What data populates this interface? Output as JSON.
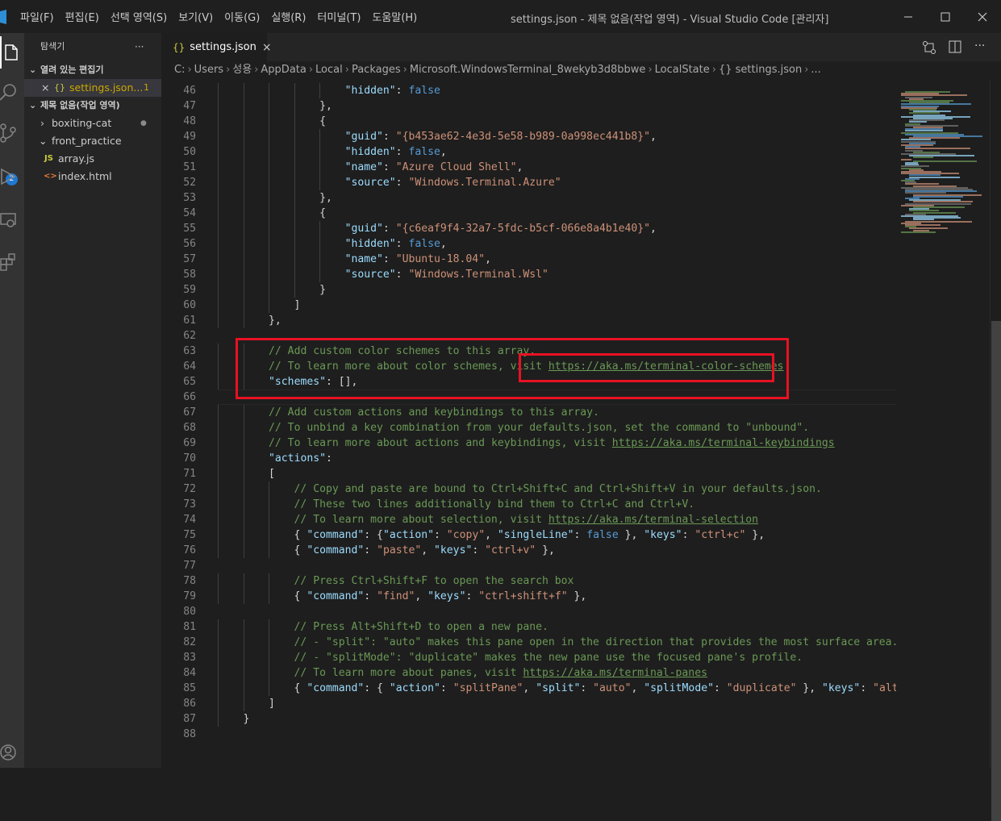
{
  "window": {
    "menu": [
      "파일(F)",
      "편집(E)",
      "선택 영역(S)",
      "보기(V)",
      "이동(G)",
      "실행(R)",
      "터미널(T)",
      "도움말(H)"
    ],
    "title": "settings.json - 제목 없음(작업 영역) - Visual Studio Code [관리자]",
    "controls": [
      "minimize",
      "maximize",
      "close"
    ]
  },
  "activity_bar": {
    "items": [
      "explorer-icon",
      "search-icon",
      "source-control-icon",
      "run-debug-icon",
      "remote-explorer-icon",
      "extensions-icon",
      "account-icon"
    ],
    "source_control_badge": "2"
  },
  "sidebar": {
    "title": "탐색기",
    "more": "···",
    "open_editors_header": "열려 있는 편집기",
    "open_editors": [
      {
        "close": "×",
        "icon": "{}",
        "name": "settings.json...",
        "badge": "1"
      }
    ],
    "workspace_header": "제목 없음(작업 영역)",
    "tree": [
      {
        "name": "boxiting-cat",
        "kind": "folder",
        "expanded": false,
        "dot": "●"
      },
      {
        "name": "front_practice",
        "kind": "folder",
        "expanded": true
      },
      {
        "name": "array.js",
        "kind": "js",
        "icon": "JS"
      },
      {
        "name": "index.html",
        "kind": "html",
        "icon": "<>"
      }
    ]
  },
  "editor": {
    "tab": {
      "icon": "{}",
      "label": "settings.json",
      "close": "×"
    },
    "breadcrumb": [
      "C:",
      "Users",
      "성용",
      "AppData",
      "Local",
      "Packages",
      "Microsoft.WindowsTerminal_8wekyb3d8bbwe",
      "LocalState",
      "{} settings.json",
      "..."
    ],
    "lines": [
      {
        "n": "46",
        "indent": 5,
        "t": [
          [
            "k",
            "\"hidden\""
          ],
          [
            "p",
            ": "
          ],
          [
            "kw",
            "false"
          ]
        ]
      },
      {
        "n": "47",
        "indent": 4,
        "t": [
          [
            "p",
            "},"
          ]
        ]
      },
      {
        "n": "48",
        "indent": 4,
        "t": [
          [
            "p",
            "{"
          ]
        ]
      },
      {
        "n": "49",
        "indent": 5,
        "t": [
          [
            "k",
            "\"guid\""
          ],
          [
            "p",
            ": "
          ],
          [
            "s",
            "\"{b453ae62-4e3d-5e58-b989-0a998ec441b8}\""
          ],
          [
            "p",
            ","
          ]
        ]
      },
      {
        "n": "50",
        "indent": 5,
        "t": [
          [
            "k",
            "\"hidden\""
          ],
          [
            "p",
            ": "
          ],
          [
            "kw",
            "false"
          ],
          [
            "p",
            ","
          ]
        ]
      },
      {
        "n": "51",
        "indent": 5,
        "t": [
          [
            "k",
            "\"name\""
          ],
          [
            "p",
            ": "
          ],
          [
            "s",
            "\"Azure Cloud Shell\""
          ],
          [
            "p",
            ","
          ]
        ]
      },
      {
        "n": "52",
        "indent": 5,
        "t": [
          [
            "k",
            "\"source\""
          ],
          [
            "p",
            ": "
          ],
          [
            "s",
            "\"Windows.Terminal.Azure\""
          ]
        ]
      },
      {
        "n": "53",
        "indent": 4,
        "t": [
          [
            "p",
            "},"
          ]
        ]
      },
      {
        "n": "54",
        "indent": 4,
        "t": [
          [
            "p",
            "{"
          ]
        ]
      },
      {
        "n": "55",
        "indent": 5,
        "t": [
          [
            "k",
            "\"guid\""
          ],
          [
            "p",
            ": "
          ],
          [
            "s",
            "\"{c6eaf9f4-32a7-5fdc-b5cf-066e8a4b1e40}\""
          ],
          [
            "p",
            ","
          ]
        ]
      },
      {
        "n": "56",
        "indent": 5,
        "t": [
          [
            "k",
            "\"hidden\""
          ],
          [
            "p",
            ": "
          ],
          [
            "kw",
            "false"
          ],
          [
            "p",
            ","
          ]
        ]
      },
      {
        "n": "57",
        "indent": 5,
        "t": [
          [
            "k",
            "\"name\""
          ],
          [
            "p",
            ": "
          ],
          [
            "s",
            "\"Ubuntu-18.04\""
          ],
          [
            "p",
            ","
          ]
        ]
      },
      {
        "n": "58",
        "indent": 5,
        "t": [
          [
            "k",
            "\"source\""
          ],
          [
            "p",
            ": "
          ],
          [
            "s",
            "\"Windows.Terminal.Wsl\""
          ]
        ]
      },
      {
        "n": "59",
        "indent": 4,
        "t": [
          [
            "p",
            "}"
          ]
        ]
      },
      {
        "n": "60",
        "indent": 3,
        "t": [
          [
            "p",
            "]"
          ]
        ]
      },
      {
        "n": "61",
        "indent": 2,
        "t": [
          [
            "p",
            "},"
          ]
        ]
      },
      {
        "n": "62",
        "indent": 0,
        "t": []
      },
      {
        "n": "63",
        "indent": 2,
        "t": [
          [
            "c",
            "// Add custom color schemes to this array."
          ]
        ]
      },
      {
        "n": "64",
        "indent": 2,
        "t": [
          [
            "c",
            "// To learn more about color schemes, visit "
          ],
          [
            "cu",
            "https://aka.ms/terminal-color-schemes"
          ]
        ]
      },
      {
        "n": "65",
        "indent": 2,
        "t": [
          [
            "k",
            "\"schemes\""
          ],
          [
            "p",
            ": [],"
          ]
        ]
      },
      {
        "n": "66",
        "indent": 0,
        "t": []
      },
      {
        "n": "67",
        "indent": 2,
        "t": [
          [
            "c",
            "// Add custom actions and keybindings to this array."
          ]
        ]
      },
      {
        "n": "68",
        "indent": 2,
        "t": [
          [
            "c",
            "// To unbind a key combination from your defaults.json, set the command to \"unbound\"."
          ]
        ]
      },
      {
        "n": "69",
        "indent": 2,
        "t": [
          [
            "c",
            "// To learn more about actions and keybindings, visit "
          ],
          [
            "cu",
            "https://aka.ms/terminal-keybindings"
          ]
        ]
      },
      {
        "n": "70",
        "indent": 2,
        "t": [
          [
            "k",
            "\"actions\""
          ],
          [
            "p",
            ":"
          ]
        ]
      },
      {
        "n": "71",
        "indent": 2,
        "t": [
          [
            "p",
            "["
          ]
        ]
      },
      {
        "n": "72",
        "indent": 3,
        "t": [
          [
            "c",
            "// Copy and paste are bound to Ctrl+Shift+C and Ctrl+Shift+V in your defaults.json."
          ]
        ]
      },
      {
        "n": "73",
        "indent": 3,
        "t": [
          [
            "c",
            "// These two lines additionally bind them to Ctrl+C and Ctrl+V."
          ]
        ]
      },
      {
        "n": "74",
        "indent": 3,
        "t": [
          [
            "c",
            "// To learn more about selection, visit "
          ],
          [
            "cu",
            "https://aka.ms/terminal-selection"
          ]
        ]
      },
      {
        "n": "75",
        "indent": 3,
        "t": [
          [
            "p",
            "{ "
          ],
          [
            "k",
            "\"command\""
          ],
          [
            "p",
            ": {"
          ],
          [
            "k",
            "\"action\""
          ],
          [
            "p",
            ": "
          ],
          [
            "s",
            "\"copy\""
          ],
          [
            "p",
            ", "
          ],
          [
            "k",
            "\"singleLine\""
          ],
          [
            "p",
            ": "
          ],
          [
            "kw",
            "false"
          ],
          [
            "p",
            " }, "
          ],
          [
            "k",
            "\"keys\""
          ],
          [
            "p",
            ": "
          ],
          [
            "s",
            "\"ctrl+c\""
          ],
          [
            "p",
            " },"
          ]
        ]
      },
      {
        "n": "76",
        "indent": 3,
        "t": [
          [
            "p",
            "{ "
          ],
          [
            "k",
            "\"command\""
          ],
          [
            "p",
            ": "
          ],
          [
            "s",
            "\"paste\""
          ],
          [
            "p",
            ", "
          ],
          [
            "k",
            "\"keys\""
          ],
          [
            "p",
            ": "
          ],
          [
            "s",
            "\"ctrl+v\""
          ],
          [
            "p",
            " },"
          ]
        ]
      },
      {
        "n": "77",
        "indent": 0,
        "t": []
      },
      {
        "n": "78",
        "indent": 3,
        "t": [
          [
            "c",
            "// Press Ctrl+Shift+F to open the search box"
          ]
        ]
      },
      {
        "n": "79",
        "indent": 3,
        "t": [
          [
            "p",
            "{ "
          ],
          [
            "k",
            "\"command\""
          ],
          [
            "p",
            ": "
          ],
          [
            "s",
            "\"find\""
          ],
          [
            "p",
            ", "
          ],
          [
            "k",
            "\"keys\""
          ],
          [
            "p",
            ": "
          ],
          [
            "s",
            "\"ctrl+shift+f\""
          ],
          [
            "p",
            " },"
          ]
        ]
      },
      {
        "n": "80",
        "indent": 0,
        "t": []
      },
      {
        "n": "81",
        "indent": 3,
        "t": [
          [
            "c",
            "// Press Alt+Shift+D to open a new pane."
          ]
        ]
      },
      {
        "n": "82",
        "indent": 3,
        "t": [
          [
            "c",
            "// - \"split\": \"auto\" makes this pane open in the direction that provides the most surface area."
          ]
        ]
      },
      {
        "n": "83",
        "indent": 3,
        "t": [
          [
            "c",
            "// - \"splitMode\": \"duplicate\" makes the new pane use the focused pane's profile."
          ]
        ]
      },
      {
        "n": "84",
        "indent": 3,
        "t": [
          [
            "c",
            "// To learn more about panes, visit "
          ],
          [
            "cu",
            "https://aka.ms/terminal-panes"
          ]
        ]
      },
      {
        "n": "85",
        "indent": 3,
        "t": [
          [
            "p",
            "{ "
          ],
          [
            "k",
            "\"command\""
          ],
          [
            "p",
            ": { "
          ],
          [
            "k",
            "\"action\""
          ],
          [
            "p",
            ": "
          ],
          [
            "s",
            "\"splitPane\""
          ],
          [
            "p",
            ", "
          ],
          [
            "k",
            "\"split\""
          ],
          [
            "p",
            ": "
          ],
          [
            "s",
            "\"auto\""
          ],
          [
            "p",
            ", "
          ],
          [
            "k",
            "\"splitMode\""
          ],
          [
            "p",
            ": "
          ],
          [
            "s",
            "\"duplicate\""
          ],
          [
            "p",
            " }, "
          ],
          [
            "k",
            "\"keys\""
          ],
          [
            "p",
            ": "
          ],
          [
            "s",
            "\"alt+sh"
          ]
        ]
      },
      {
        "n": "86",
        "indent": 2,
        "t": [
          [
            "p",
            "]"
          ]
        ]
      },
      {
        "n": "87",
        "indent": 1,
        "t": [
          [
            "p",
            "}"
          ]
        ]
      },
      {
        "n": "88",
        "indent": 0,
        "t": []
      }
    ]
  },
  "colors": {
    "highlight_box": "#e81123",
    "comment": "#6a9955",
    "key": "#9cdcfe",
    "string": "#ce9178",
    "keyword": "#569cd6"
  }
}
